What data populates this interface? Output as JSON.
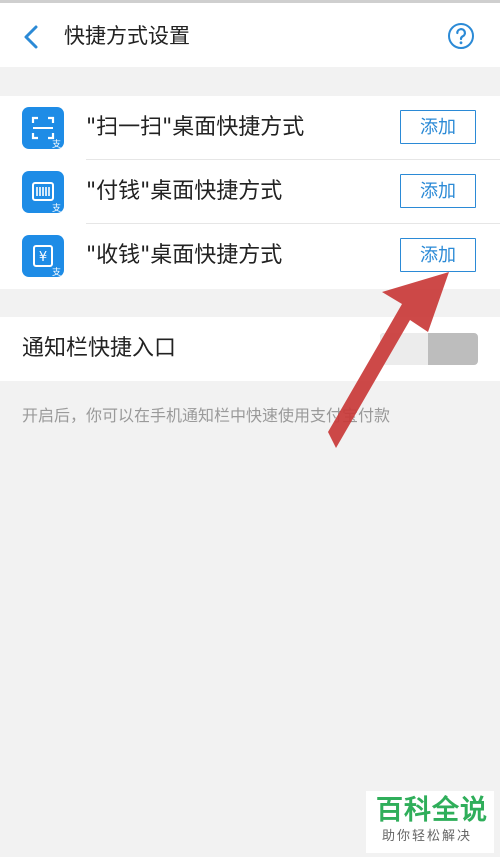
{
  "header": {
    "title": "快捷方式设置",
    "back_icon": "chevron-left-icon",
    "help_icon": "help-circle-icon"
  },
  "shortcuts": [
    {
      "label": "\"扫一扫\"桌面快捷方式",
      "button": "添加",
      "icon": "scan-icon"
    },
    {
      "label": "\"付钱\"桌面快捷方式",
      "button": "添加",
      "icon": "barcode-icon"
    },
    {
      "label": "\"收钱\"桌面快捷方式",
      "button": "添加",
      "icon": "yuan-receipt-icon"
    }
  ],
  "notification": {
    "label": "通知栏快捷入口",
    "toggle_on": false
  },
  "hint": "开启后，你可以在手机通知栏中快速使用支付宝付款",
  "watermark": {
    "main": "百科全说",
    "sub": "助你轻松解决"
  },
  "colors": {
    "accent": "#2b8ad6",
    "icon_bg": "#1e8ce6",
    "arrow": "#c93a38",
    "watermark_green": "#2fae5a"
  }
}
